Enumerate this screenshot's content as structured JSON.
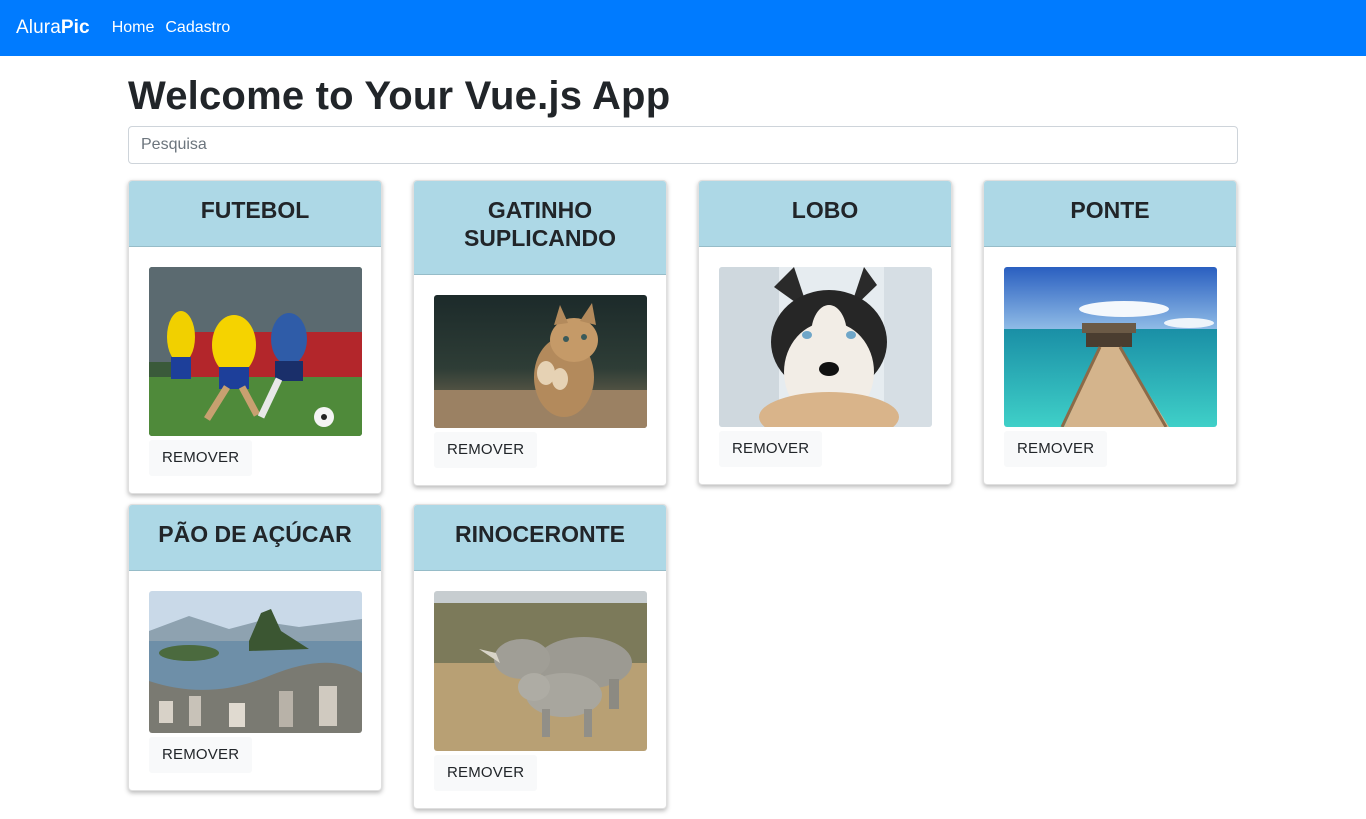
{
  "navbar": {
    "brand_light": "Alura",
    "brand_bold": "Pic",
    "links": [
      "Home",
      "Cadastro"
    ]
  },
  "main": {
    "title": "Welcome to Your Vue.js App",
    "search_placeholder": "Pesquisa",
    "remove_label": "REMOVER",
    "cards": [
      {
        "title": "FUTEBOL"
      },
      {
        "title": "GATINHO SUPLICANDO"
      },
      {
        "title": "LOBO"
      },
      {
        "title": "PONTE"
      },
      {
        "title": "PÃO DE AÇÚCAR"
      },
      {
        "title": "RINOCERONTE"
      }
    ]
  },
  "colors": {
    "navbar": "#007bff",
    "card_header": "#add8e6",
    "button_bg": "#f8f9fa"
  }
}
